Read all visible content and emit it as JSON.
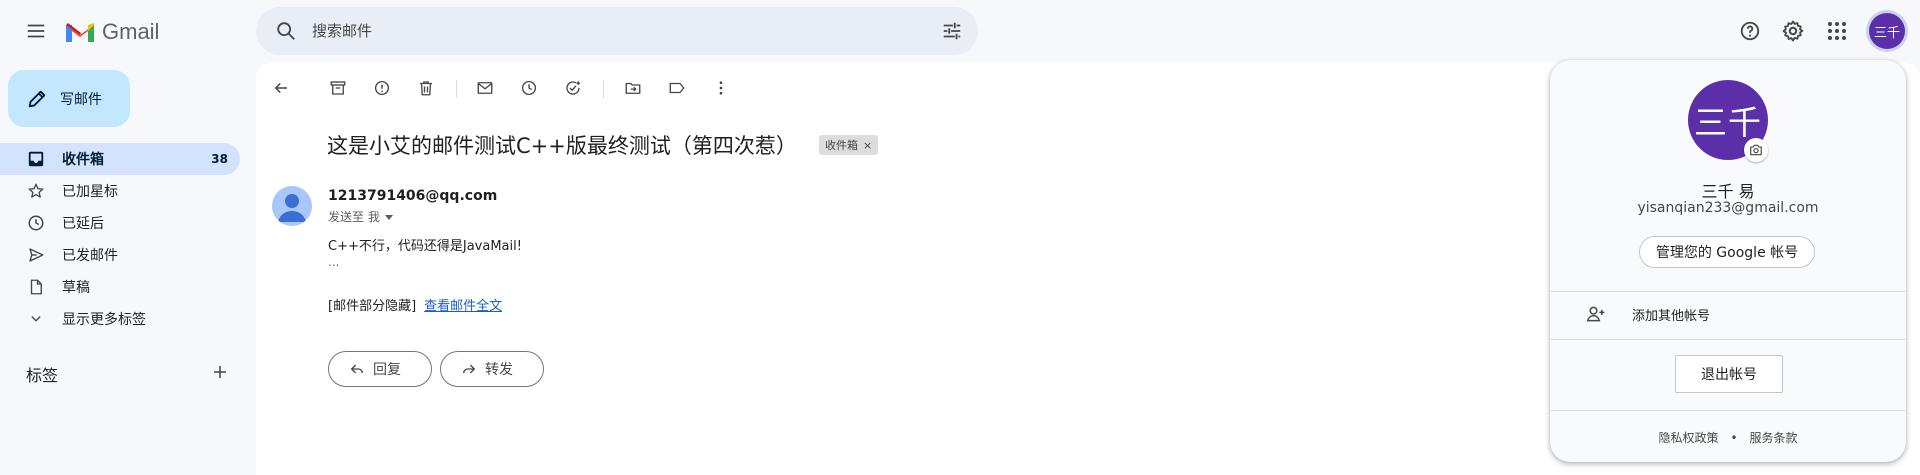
{
  "header": {
    "logo_text": "Gmail",
    "search_placeholder": "搜索邮件",
    "avatar_text": "三千"
  },
  "sidebar": {
    "compose_label": "写邮件",
    "items": [
      {
        "label": "收件箱",
        "count": "38",
        "icon": "inbox-icon"
      },
      {
        "label": "已加星标",
        "icon": "star-icon"
      },
      {
        "label": "已延后",
        "icon": "clock-icon"
      },
      {
        "label": "已发邮件",
        "icon": "send-icon"
      },
      {
        "label": "草稿",
        "icon": "draft-icon"
      },
      {
        "label": "显示更多标签",
        "icon": "chevron-down-icon"
      }
    ],
    "labels_title": "标签"
  },
  "email": {
    "subject": "这是小艾的邮件测试C++版最终测试（第四次惹）",
    "label_chip": "收件箱",
    "sender": "1213791406@qq.com",
    "to": "发送至 我",
    "body": "C++不行，代码还得是JavaMail!",
    "ellipsis": "...",
    "clipped_text": "[邮件部分隐藏]",
    "view_full_link": "查看邮件全文",
    "reply_label": "回复",
    "forward_label": "转发"
  },
  "account": {
    "avatar_text": "三千",
    "name": "三千 易",
    "email": "yisanqian233@gmail.com",
    "manage_label": "管理您的 Google 帐号",
    "add_account_label": "添加其他帐号",
    "signout_label": "退出帐号",
    "privacy_label": "隐私权政策",
    "separator": "•",
    "terms_label": "服务条款"
  },
  "colors": {
    "accent": "#c2e7ff",
    "active_nav": "#d3e3fd",
    "avatar_purple": "#5b2fa8",
    "link": "#1a5fc9"
  }
}
